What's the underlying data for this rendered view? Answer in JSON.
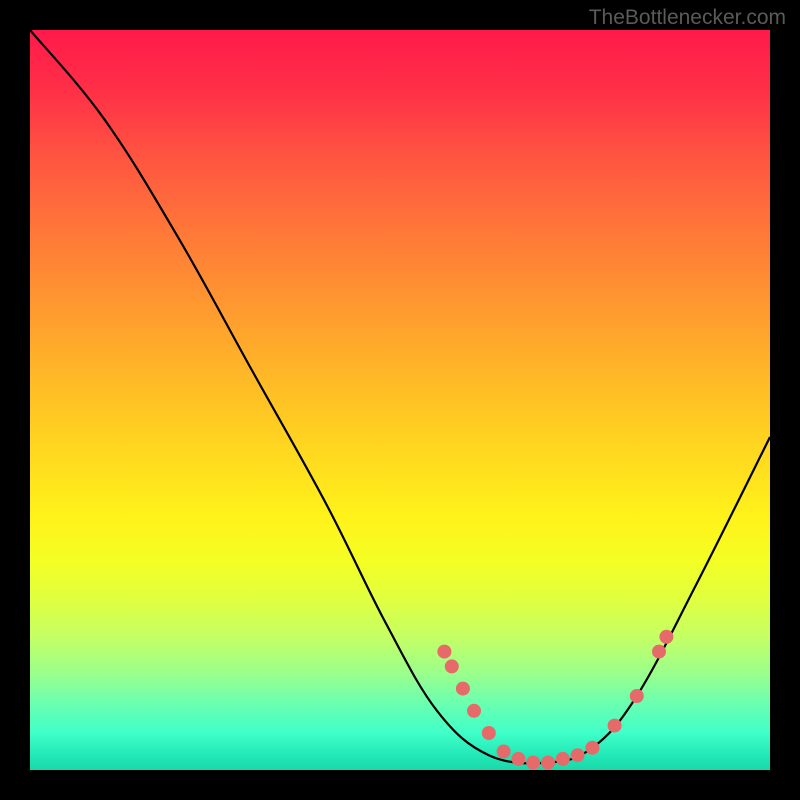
{
  "watermark": "TheBottlenecker.com",
  "chart_data": {
    "type": "line",
    "title": "",
    "xlabel": "",
    "ylabel": "",
    "xlim": [
      0,
      100
    ],
    "ylim": [
      0,
      100
    ],
    "curve": [
      {
        "x": 0,
        "y": 100
      },
      {
        "x": 10,
        "y": 88
      },
      {
        "x": 20,
        "y": 72
      },
      {
        "x": 30,
        "y": 54
      },
      {
        "x": 40,
        "y": 36
      },
      {
        "x": 48,
        "y": 20
      },
      {
        "x": 55,
        "y": 8
      },
      {
        "x": 62,
        "y": 2
      },
      {
        "x": 70,
        "y": 1
      },
      {
        "x": 76,
        "y": 3
      },
      {
        "x": 82,
        "y": 10
      },
      {
        "x": 90,
        "y": 25
      },
      {
        "x": 100,
        "y": 45
      }
    ],
    "markers": [
      {
        "x": 56,
        "y": 16
      },
      {
        "x": 57,
        "y": 14
      },
      {
        "x": 58.5,
        "y": 11
      },
      {
        "x": 60,
        "y": 8
      },
      {
        "x": 62,
        "y": 5
      },
      {
        "x": 64,
        "y": 2.5
      },
      {
        "x": 66,
        "y": 1.5
      },
      {
        "x": 68,
        "y": 1
      },
      {
        "x": 70,
        "y": 1
      },
      {
        "x": 72,
        "y": 1.5
      },
      {
        "x": 74,
        "y": 2
      },
      {
        "x": 76,
        "y": 3
      },
      {
        "x": 79,
        "y": 6
      },
      {
        "x": 82,
        "y": 10
      },
      {
        "x": 85,
        "y": 16
      },
      {
        "x": 86,
        "y": 18
      }
    ],
    "gradient_stops": [
      {
        "pos": 0,
        "color": "#ff1a4a"
      },
      {
        "pos": 50,
        "color": "#ffdb1f"
      },
      {
        "pos": 100,
        "color": "#1ad8a8"
      }
    ]
  }
}
